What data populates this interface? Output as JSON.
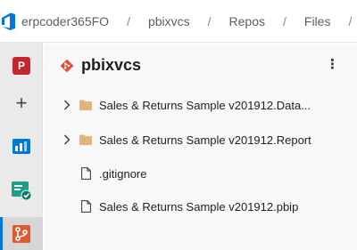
{
  "header": {
    "breadcrumbs": [
      "erpcoder365FO",
      "pbixvcs",
      "Repos",
      "Files"
    ],
    "separator": "/"
  },
  "nav": {
    "project_initial": "P",
    "add_symbol": "+",
    "items": [
      "project-avatar",
      "add-icon",
      "boards-icon",
      "test-plans-icon",
      "repos-icon"
    ],
    "active_item": "repos-icon"
  },
  "repo": {
    "name": "pbixvcs",
    "more_symbol": "⋮",
    "files": [
      {
        "name": "Sales & Returns Sample v201912.Data...",
        "type": "folder",
        "icon": "folder-icon"
      },
      {
        "name": "Sales & Returns Sample v201912.Report",
        "type": "folder",
        "icon": "folder-icon"
      },
      {
        "name": ".gitignore",
        "type": "file",
        "icon": "file-icon"
      },
      {
        "name": "Sales & Returns Sample v201912.pbip",
        "type": "file",
        "icon": "file-icon"
      }
    ]
  },
  "colors": {
    "accent": "#0078d4",
    "git_brand": "#e0503a",
    "folder": "#dcb67a",
    "project_badge": "#c4262e"
  }
}
